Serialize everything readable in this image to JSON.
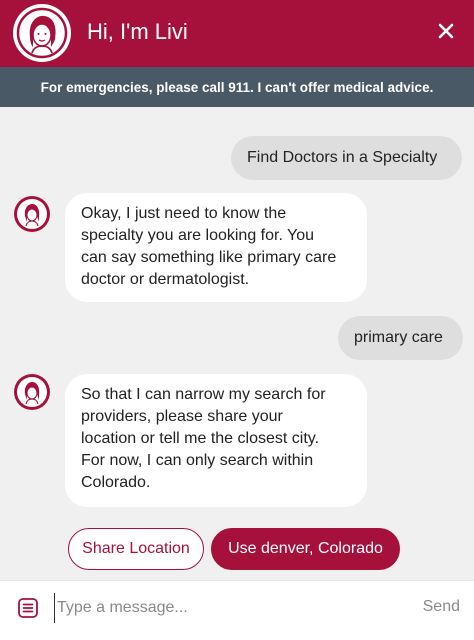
{
  "header": {
    "title": "Hi, I'm Livi",
    "avatar_icon": "livi-avatar-icon",
    "close_icon": "close-icon",
    "color": "#a6113c"
  },
  "banner": {
    "text": "For emergencies, please call 911. I can't offer medical advice.",
    "color": "#4a5966"
  },
  "messages": [
    {
      "from": "user",
      "text": "Find Doctors in a Specialty"
    },
    {
      "from": "bot",
      "lines": [
        "Okay, I just need to know the",
        "specialty you are looking for. You",
        "can say something like primary care",
        "doctor or dermatologist."
      ]
    },
    {
      "from": "user",
      "text": "primary care"
    },
    {
      "from": "bot",
      "lines": [
        "So that I can narrow my search for",
        "providers, please share your",
        "location or tell me the closest city.",
        "For now, I can only search within",
        "Colorado."
      ]
    }
  ],
  "quick_replies": {
    "share_location": "Share Location",
    "use_city": "Use denver, Colorado"
  },
  "composer": {
    "placeholder": "Type a message...",
    "send_label": "Send",
    "menu_icon": "menu-icon"
  }
}
